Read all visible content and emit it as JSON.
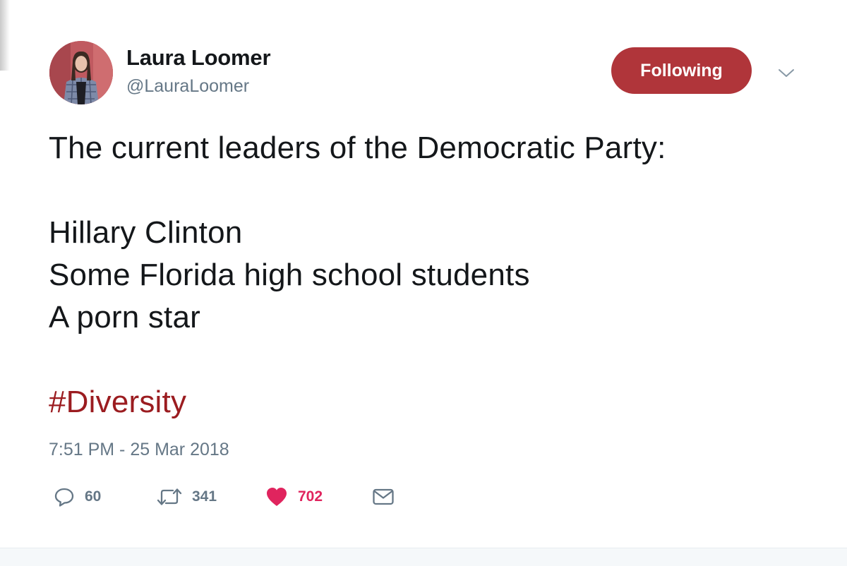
{
  "tweet": {
    "author": {
      "display_name": "Laura Loomer",
      "handle": "@LauraLoomer",
      "avatar_icon": "profile-photo"
    },
    "follow_button_label": "Following",
    "menu_icon": "chevron-down-icon",
    "text_lines": [
      "The current leaders of the Democratic Party:",
      "",
      "Hillary Clinton",
      "Some Florida high school students",
      "A porn star",
      "",
      "#Diversity"
    ],
    "hashtag": "#Diversity",
    "timestamp": "7:51 PM - 25 Mar 2018",
    "actions": {
      "replies": {
        "icon": "reply-icon",
        "count": "60"
      },
      "retweets": {
        "icon": "retweet-icon",
        "count": "341"
      },
      "likes": {
        "icon": "heart-icon",
        "count": "702",
        "liked": true
      },
      "message": {
        "icon": "envelope-icon"
      }
    }
  },
  "colors": {
    "follow_button": "#b0353a",
    "hashtag": "#9b1c20",
    "heart": "#e0245e",
    "secondary_text": "#657786"
  }
}
